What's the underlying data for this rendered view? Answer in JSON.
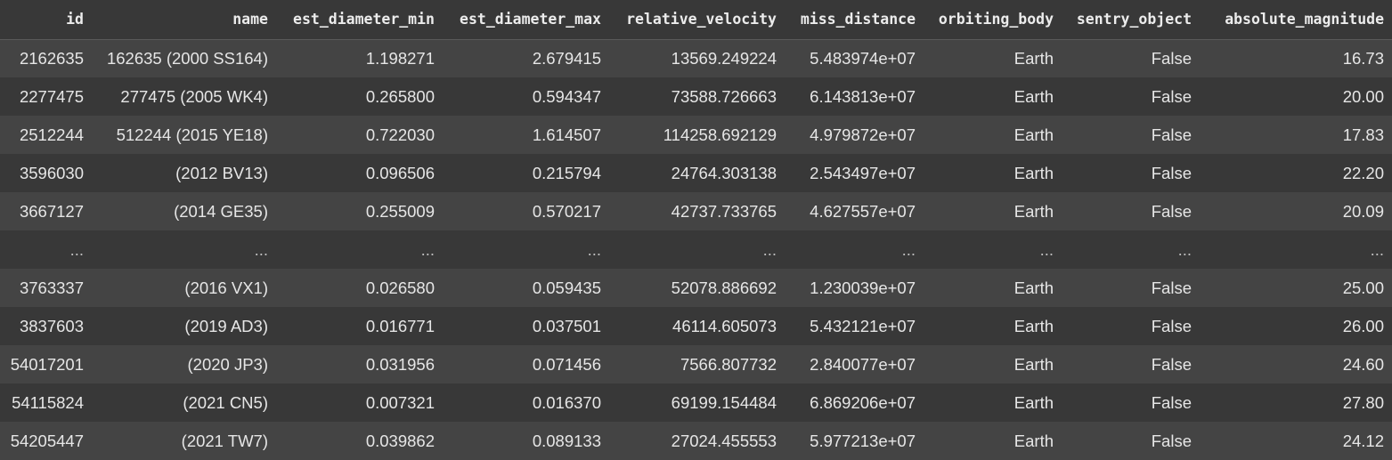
{
  "table": {
    "columns": [
      "id",
      "name",
      "est_diameter_min",
      "est_diameter_max",
      "relative_velocity",
      "miss_distance",
      "orbiting_body",
      "sentry_object",
      "absolute_magnitude"
    ],
    "rows": [
      [
        "2162635",
        "162635 (2000 SS164)",
        "1.198271",
        "2.679415",
        "13569.249224",
        "5.483974e+07",
        "Earth",
        "False",
        "16.73"
      ],
      [
        "2277475",
        "277475 (2005 WK4)",
        "0.265800",
        "0.594347",
        "73588.726663",
        "6.143813e+07",
        "Earth",
        "False",
        "20.00"
      ],
      [
        "2512244",
        "512244 (2015 YE18)",
        "0.722030",
        "1.614507",
        "114258.692129",
        "4.979872e+07",
        "Earth",
        "False",
        "17.83"
      ],
      [
        "3596030",
        "(2012 BV13)",
        "0.096506",
        "0.215794",
        "24764.303138",
        "2.543497e+07",
        "Earth",
        "False",
        "22.20"
      ],
      [
        "3667127",
        "(2014 GE35)",
        "0.255009",
        "0.570217",
        "42737.733765",
        "4.627557e+07",
        "Earth",
        "False",
        "20.09"
      ],
      [
        "...",
        "...",
        "...",
        "...",
        "...",
        "...",
        "...",
        "...",
        "..."
      ],
      [
        "3763337",
        "(2016 VX1)",
        "0.026580",
        "0.059435",
        "52078.886692",
        "1.230039e+07",
        "Earth",
        "False",
        "25.00"
      ],
      [
        "3837603",
        "(2019 AD3)",
        "0.016771",
        "0.037501",
        "46114.605073",
        "5.432121e+07",
        "Earth",
        "False",
        "26.00"
      ],
      [
        "54017201",
        "(2020 JP3)",
        "0.031956",
        "0.071456",
        "7566.807732",
        "2.840077e+07",
        "Earth",
        "False",
        "24.60"
      ],
      [
        "54115824",
        "(2021 CN5)",
        "0.007321",
        "0.016370",
        "69199.154484",
        "6.869206e+07",
        "Earth",
        "False",
        "27.80"
      ],
      [
        "54205447",
        "(2021 TW7)",
        "0.039862",
        "0.089133",
        "27024.455553",
        "5.977213e+07",
        "Earth",
        "False",
        "24.12"
      ]
    ]
  },
  "colors": {
    "background": "#383838",
    "row_alt": "#444444",
    "text": "#e6e6e6",
    "header_border": "#5a5a5a"
  }
}
